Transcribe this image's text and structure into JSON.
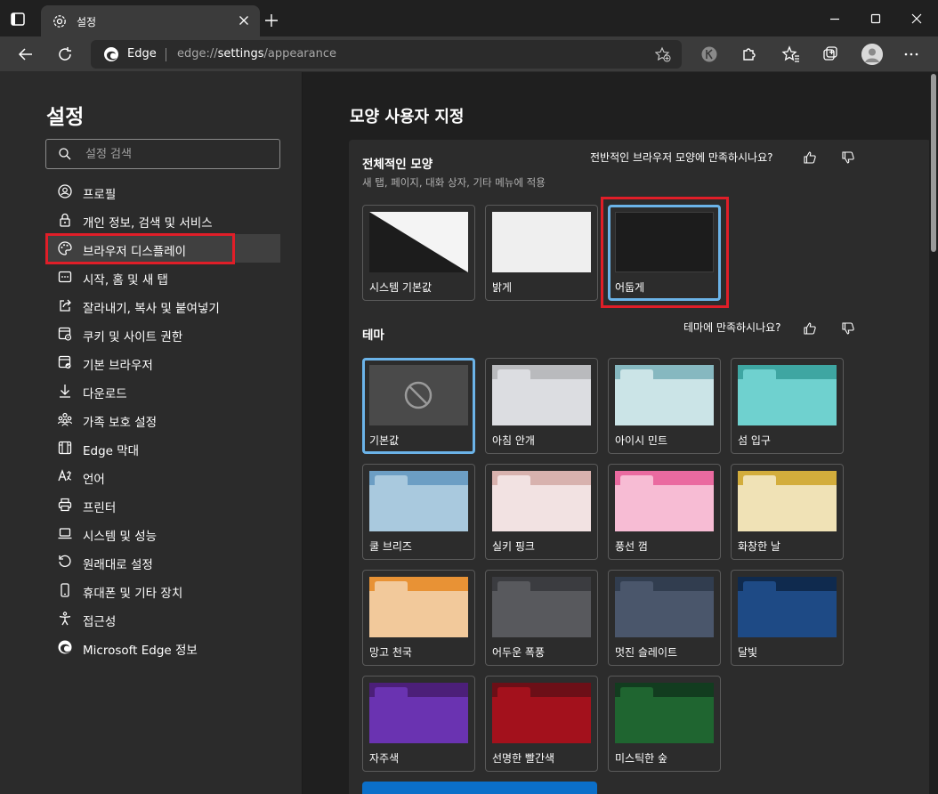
{
  "tab": {
    "title": "설정"
  },
  "address": {
    "site": "Edge",
    "url_prefix": "edge://",
    "url_bold": "settings",
    "url_suffix": "/appearance"
  },
  "sidebar": {
    "title": "설정",
    "search_placeholder": "설정 검색",
    "items": [
      {
        "label": "프로필",
        "icon": "profile-icon"
      },
      {
        "label": "개인 정보, 검색 및 서비스",
        "icon": "lock-icon"
      },
      {
        "label": "브라우저 디스플레이",
        "icon": "palette-icon",
        "active": true
      },
      {
        "label": "시작, 홈 및 새 탭",
        "icon": "start-icon"
      },
      {
        "label": "잘라내기, 복사 및 붙여넣기",
        "icon": "share-icon"
      },
      {
        "label": "쿠키 및 사이트 권한",
        "icon": "cookie-icon"
      },
      {
        "label": "기본 브라우저",
        "icon": "browser-icon"
      },
      {
        "label": "다운로드",
        "icon": "download-icon"
      },
      {
        "label": "가족 보호 설정",
        "icon": "family-icon"
      },
      {
        "label": "Edge 막대",
        "icon": "edge-bar-icon"
      },
      {
        "label": "언어",
        "icon": "language-icon"
      },
      {
        "label": "프린터",
        "icon": "printer-icon"
      },
      {
        "label": "시스템 및 성능",
        "icon": "laptop-icon"
      },
      {
        "label": "원래대로 설정",
        "icon": "reset-icon"
      },
      {
        "label": "휴대폰 및 기타 장치",
        "icon": "phone-icon"
      },
      {
        "label": "접근성",
        "icon": "accessibility-icon"
      },
      {
        "label": "Microsoft Edge 정보",
        "icon": "edge-logo-icon"
      }
    ]
  },
  "main": {
    "title": "모양 사용자 지정",
    "overall": {
      "title": "전체적인 모양",
      "subtitle": "새 탭, 페이지, 대화 상자, 기타 메뉴에 적용",
      "feedback": "전반적인 브라우저 모양에 만족하시나요?",
      "options": [
        {
          "label": "시스템 기본값"
        },
        {
          "label": "밝게"
        },
        {
          "label": "어둡게",
          "selected": true
        }
      ]
    },
    "theme": {
      "title": "테마",
      "feedback": "테마에 만족하시나요?",
      "options": [
        {
          "label": "기본값",
          "selected": true
        },
        {
          "label": "아침 안개",
          "tab": "#b9babd",
          "body": "#dcdde1",
          "back": "#d2d3d7"
        },
        {
          "label": "아이시 민트",
          "tab": "#86b8c0",
          "body": "#cbe4e7",
          "back": "#bcdadf"
        },
        {
          "label": "섬 입구",
          "tab": "#3ea6a2",
          "body": "#6fd1cf",
          "back": "#5ec4c2"
        },
        {
          "label": "쿨 브리즈",
          "tab": "#6c9ec4",
          "body": "#a9c9de",
          "back": "#9abfd8"
        },
        {
          "label": "실키 핑크",
          "tab": "#d8b2ae",
          "body": "#f2e2e2",
          "back": "#e9d4d3"
        },
        {
          "label": "풍선 껌",
          "tab": "#ea6aa0",
          "body": "#f7bcd4",
          "back": "#f3a9c8"
        },
        {
          "label": "화창한 날",
          "tab": "#d3ad3c",
          "body": "#f0e2b6",
          "back": "#e9d7a2"
        },
        {
          "label": "망고 천국",
          "tab": "#e89235",
          "body": "#f2c99b",
          "back": "#eebd89"
        },
        {
          "label": "어두운 폭풍",
          "tab": "#3b3c40",
          "body": "#58595d",
          "back": "#4c4d51"
        },
        {
          "label": "멋진 슬레이트",
          "tab": "#313d4f",
          "body": "#4a566b",
          "back": "#414c60"
        },
        {
          "label": "달빛",
          "tab": "#0f2a4e",
          "body": "#1e4a85",
          "back": "#183e72"
        },
        {
          "label": "자주색",
          "tab": "#4c1f79",
          "body": "#6a33b1",
          "back": "#5e2ba0"
        },
        {
          "label": "선명한 빨간색",
          "tab": "#6c0f17",
          "body": "#a3111c",
          "back": "#8e0f19"
        },
        {
          "label": "미스틱한 숲",
          "tab": "#123c1f",
          "body": "#1f6530",
          "back": "#1a5629"
        }
      ]
    }
  },
  "colors": {
    "highlight": "#e01e28",
    "accent": "#4cc2ff",
    "selected_border": "#6bb3e8",
    "button": "#0b6fc9"
  }
}
